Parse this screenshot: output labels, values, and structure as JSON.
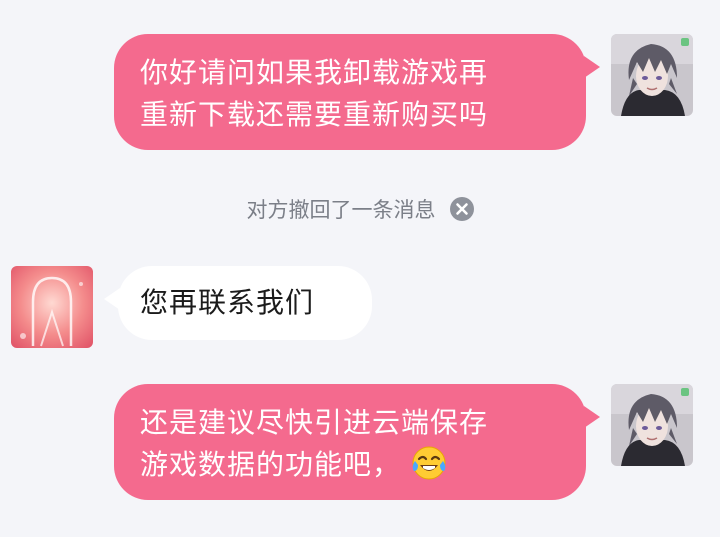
{
  "messages": [
    {
      "side": "out",
      "lines": [
        "你好请问如果我卸载游戏再",
        "重新下载还需要重新购买吗"
      ],
      "avatar_icon": "anime-character-avatar-icon"
    },
    {
      "side": "system",
      "text": "对方撤回了一条消息",
      "action_icon": "close-circle-icon"
    },
    {
      "side": "in",
      "text": "您再联系我们",
      "avatar_icon": "pink-abstract-avatar-icon"
    },
    {
      "side": "out",
      "lines": [
        "还是建议尽快引进云端保存",
        "游戏数据的功能吧，"
      ],
      "emoji": "tears-of-joy-emoji-icon",
      "avatar_icon": "anime-character-avatar-icon"
    }
  ],
  "colors": {
    "background": "#f4f5f9",
    "outgoing_bubble": "#f46a8e",
    "incoming_bubble": "#ffffff",
    "system_text": "#7b7f88",
    "close_icon": "#8e929b"
  }
}
